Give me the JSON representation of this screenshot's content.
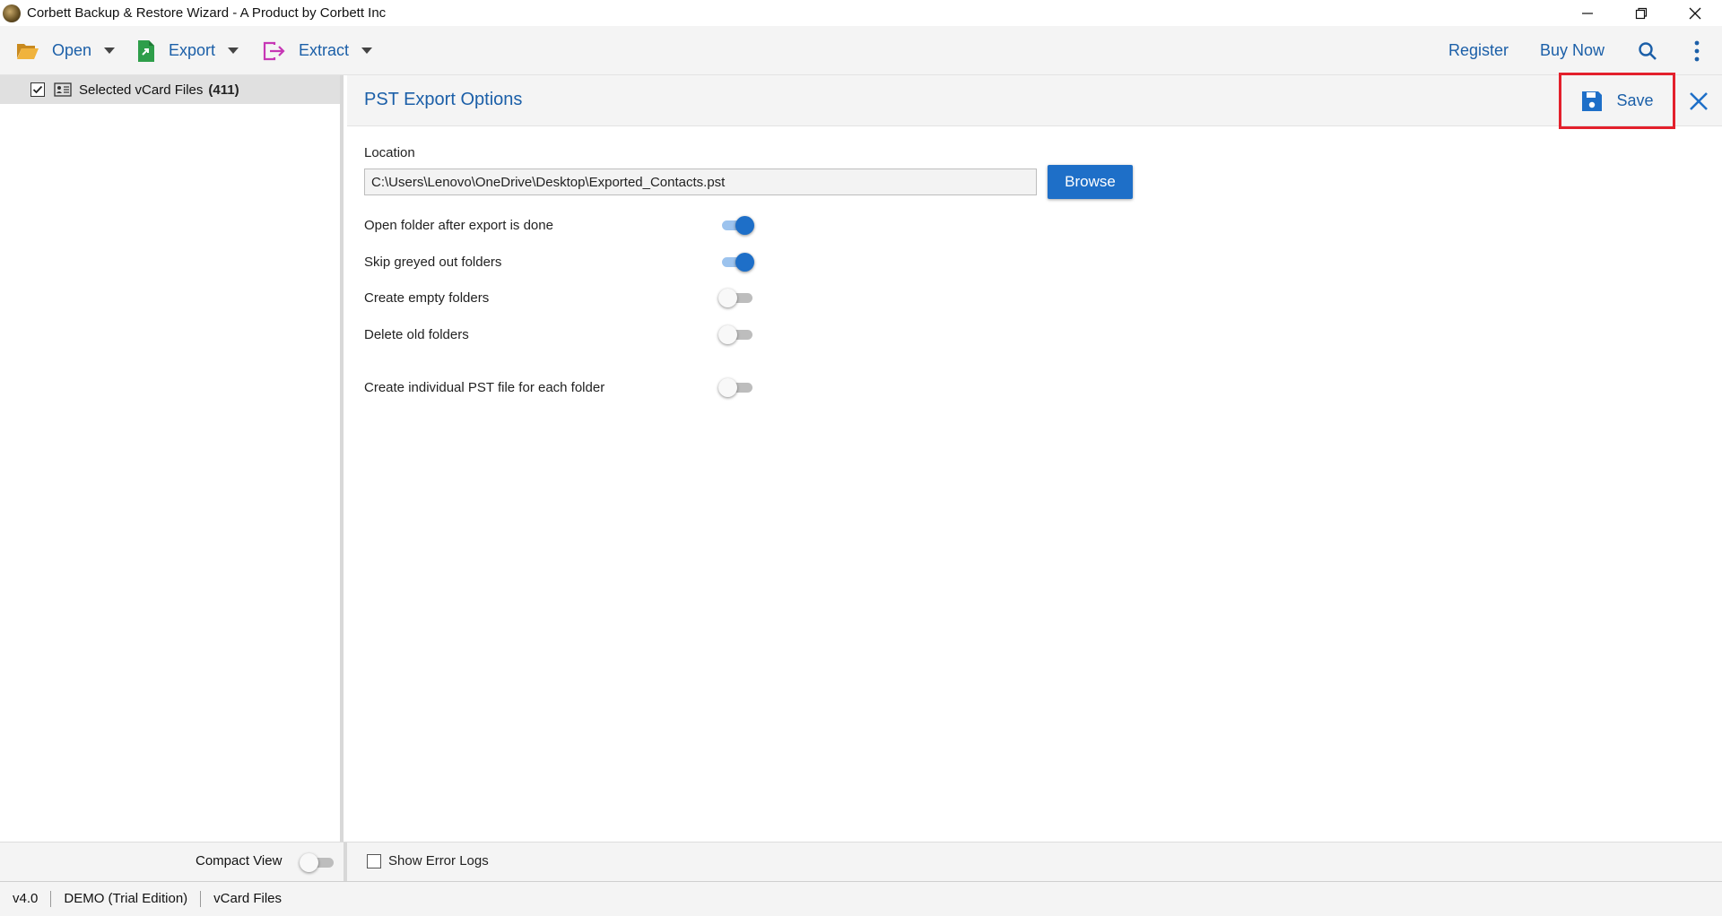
{
  "window": {
    "title": "Corbett Backup & Restore Wizard - A Product by Corbett Inc",
    "controls": [
      "minimize",
      "restore",
      "close"
    ]
  },
  "toolbar": {
    "open_label": "Open",
    "export_label": "Export",
    "extract_label": "Extract",
    "register_label": "Register",
    "buy_now_label": "Buy Now",
    "icons": {
      "open": "folder-open-icon",
      "export": "export-file-icon",
      "extract": "extract-icon",
      "search": "search-icon",
      "more": "kebab-menu-icon"
    },
    "colors": {
      "open_icon": "#e8a630",
      "export_icon": "#2e9e4a",
      "extract_icon": "#c637b5",
      "link": "#1b5fa8"
    }
  },
  "sidebar": {
    "tree": [
      {
        "label": "Selected vCard Files",
        "count": "(411)",
        "checked": true
      }
    ],
    "compact_view_label": "Compact View",
    "compact_view_on": false
  },
  "export_panel": {
    "title": "PST Export Options",
    "save_label": "Save",
    "location_label": "Location",
    "location_value": "C:\\Users\\Lenovo\\OneDrive\\Desktop\\Exported_Contacts.pst",
    "browse_label": "Browse",
    "options": [
      {
        "label": "Open folder after export is done",
        "on": true
      },
      {
        "label": "Skip greyed out folders",
        "on": true
      },
      {
        "label": "Create empty folders",
        "on": false
      },
      {
        "label": "Delete old folders",
        "on": false
      },
      {
        "label": "Create individual PST file for each folder",
        "on": false
      }
    ],
    "show_error_logs_label": "Show Error Logs",
    "show_error_logs_checked": false,
    "highlight_color": "#e3202c",
    "accent_color": "#1e6fc8"
  },
  "statusbar": {
    "version": "v4.0",
    "edition": "DEMO (Trial Edition)",
    "mode": "vCard Files"
  }
}
